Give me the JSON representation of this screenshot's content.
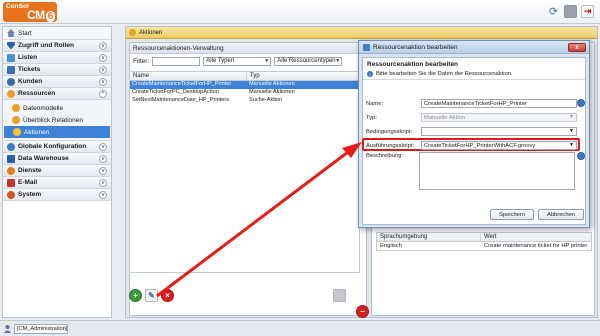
{
  "app": {
    "logo_line1": "ConSol",
    "logo_line2": "CM",
    "logo_version": "6"
  },
  "nav": {
    "start": "Start",
    "sections": [
      {
        "label": "Zugriff und Rollen"
      },
      {
        "label": "Listen"
      },
      {
        "label": "Tickets"
      },
      {
        "label": "Kunden"
      },
      {
        "label": "Ressourcen"
      }
    ],
    "sub_items": [
      {
        "label": "Datenmodelle"
      },
      {
        "label": "Überblick Relationen"
      },
      {
        "label": "Aktionen"
      }
    ],
    "sections_after": [
      {
        "label": "Globale Konfiguration"
      },
      {
        "label": "Data Warehouse"
      },
      {
        "label": "Dienste"
      },
      {
        "label": "E-Mail"
      },
      {
        "label": "System"
      }
    ]
  },
  "main": {
    "tab_label": "Aktionen",
    "panel_title": "Ressourcenaktionen-Verwaltung",
    "filter_label": "Filter:",
    "filter_value": "",
    "type_select": "Alle Typen",
    "resource_select": "Alle Ressourcentypen",
    "columns": [
      "Name",
      "Typ"
    ],
    "rows": [
      {
        "name": "CreateMaintenanceTicketForHP_Printer",
        "type": "Manuelle Aktionen"
      },
      {
        "name": "CreateTicketForPC_DesktopAction",
        "type": "Manuelle Aktionen"
      },
      {
        "name": "SetNextMaintenanceDate_HP_Printers",
        "type": "Suche-Aktion"
      }
    ]
  },
  "lang_table": {
    "columns": [
      "Sprachumgebung",
      "Wert"
    ],
    "rows": [
      {
        "lang": "Englisch",
        "value": "Create maintenance ticket for HP printer"
      }
    ]
  },
  "status": {
    "user": "[CM_Administration]"
  },
  "dialog": {
    "title": "Ressourcenaktion bearbeiten",
    "close": "x",
    "heading": "Ressourcenaktion bearbeiten",
    "info": "Bitte bearbeiten Sie die Daten der Ressourcenaktion.",
    "name_label": "Name:",
    "name_value": "CreateMaintenanceTicketForHP_Printer",
    "type_label": "Typ:",
    "type_value": "Manuelle Aktion",
    "condition_label": "Bedingungsskript:",
    "condition_value": "",
    "exec_label": "Ausführungsskript:",
    "exec_value": "CreateTicketForHP_PrinterWithACF.groovy",
    "desc_label": "Beschreibung:",
    "save": "Speichern",
    "cancel": "Abbrechen"
  }
}
